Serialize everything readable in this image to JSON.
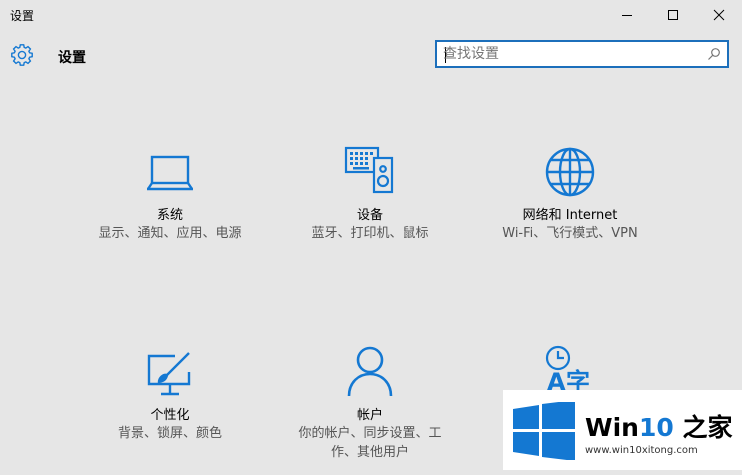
{
  "window": {
    "title": "设置"
  },
  "header": {
    "title": "设置"
  },
  "search": {
    "placeholder": "查找设置"
  },
  "tiles": [
    {
      "name": "系统",
      "desc": "显示、通知、应用、电源",
      "icon": "laptop-icon"
    },
    {
      "name": "设备",
      "desc": "蓝牙、打印机、鼠标",
      "icon": "keyboard-speaker-icon"
    },
    {
      "name": "网络和 Internet",
      "desc": "Wi-Fi、飞行模式、VPN",
      "icon": "globe-icon"
    },
    {
      "name": "个性化",
      "desc": "背景、锁屏、颜色",
      "icon": "paint-brush-icon"
    },
    {
      "name": "帐户",
      "desc": "你的帐户、同步设置、工作、其他用户",
      "icon": "user-icon"
    },
    {
      "name": "",
      "desc": "",
      "icon": "time-language-icon"
    }
  ],
  "watermark": {
    "brand_prefix": "Win",
    "brand_num": "10",
    "brand_suffix": " 之家",
    "url": "www.win10xitong.com"
  },
  "colors": {
    "accent": "#1478d2",
    "background": "#e6e6e6"
  }
}
